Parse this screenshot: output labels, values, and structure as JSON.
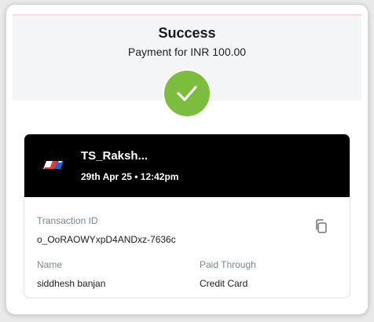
{
  "header": {
    "title": "Success",
    "subtitle": "Payment for INR 100.00"
  },
  "icons": {
    "status": "checkmark-icon",
    "copy": "copy-icon",
    "logo": "merchant-logo"
  },
  "colors": {
    "success": "#7cbd3d",
    "card_header": "#000000",
    "label": "#7b8794"
  },
  "card": {
    "merchant_name": "TS_Raksh...",
    "datetime": "29th Apr 25 • 12:42pm",
    "transaction_id_label": "Transaction ID",
    "transaction_id": "o_OoRAOWYxpD4ANDxz-7636c",
    "name_label": "Name",
    "name": "siddhesh banjan",
    "paid_through_label": "Paid Through",
    "paid_through": "Credit Card"
  }
}
